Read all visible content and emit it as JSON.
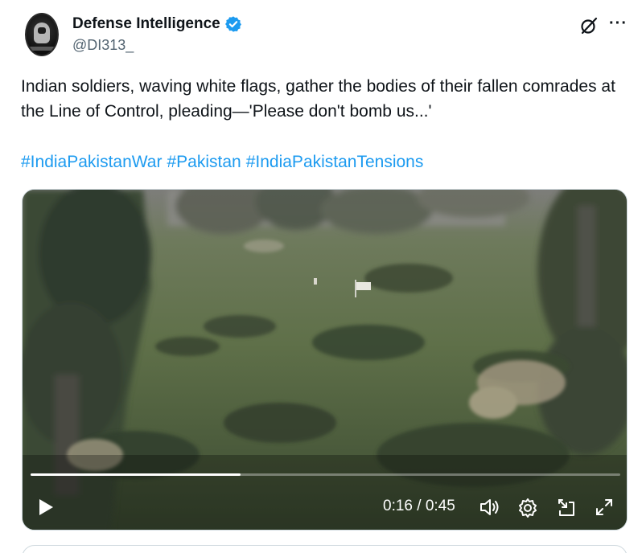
{
  "author": {
    "display_name": "Defense Intelligence",
    "handle": "@DI313_",
    "verified": true
  },
  "header_icons": {
    "grok": "grok-icon",
    "more": "more-icon"
  },
  "tweet": {
    "text": "Indian soldiers, waving white flags, gather the bodies of their fallen comrades at the Line of Control, pleading—'Please don't bomb us...'",
    "hashtags": [
      "#IndiaPakistanWar",
      "#Pakistan",
      "#IndiaPakistanTensions"
    ]
  },
  "video": {
    "current_time": "0:16",
    "duration": "0:45",
    "time_display": "0:16 / 0:45",
    "progress": 0.356,
    "controls": [
      "play-icon",
      "volume-icon",
      "settings-icon",
      "pip-icon",
      "fullscreen-icon"
    ]
  },
  "colors": {
    "link": "#1d9bf0",
    "verified": "#1d9bf0",
    "text": "#0f1419",
    "muted": "#536471"
  }
}
